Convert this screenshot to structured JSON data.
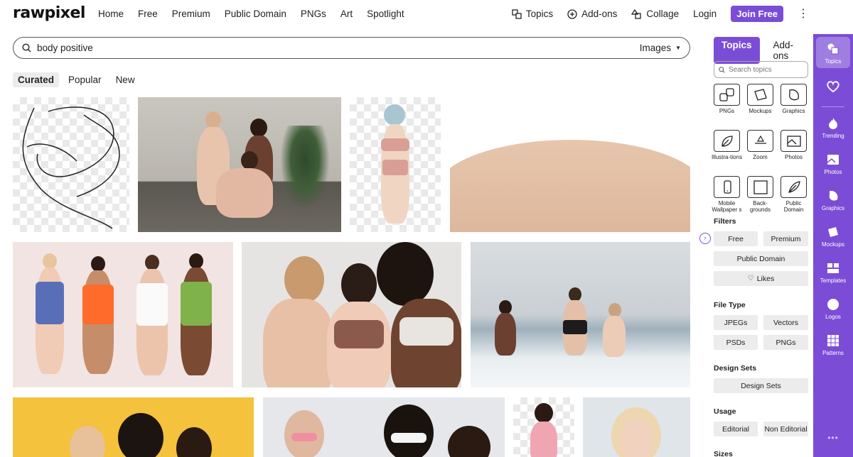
{
  "brand": "rawpixel",
  "nav": [
    "Home",
    "Free",
    "Premium",
    "Public Domain",
    "PNGs",
    "Art",
    "Spotlight"
  ],
  "header_right": {
    "topics": "Topics",
    "addons": "Add-ons",
    "collage": "Collage",
    "login": "Login",
    "join": "Join Free"
  },
  "search": {
    "value": "body positive",
    "type": "Images"
  },
  "sort_tabs": {
    "curated": "Curated",
    "popular": "Popular",
    "new": "New"
  },
  "panel": {
    "tabs": [
      "Topics",
      "Add-ons"
    ],
    "search_placeholder": "Search topics",
    "topics": [
      "PNGs",
      "Mockups",
      "Graphics",
      "Illustra-tions",
      "Zoom",
      "Photos",
      "Mobile Wallpaper s",
      "Back-grounds",
      "Public Domain"
    ],
    "filters_title": "Filters",
    "filters": {
      "free": "Free",
      "premium": "Premium",
      "public_domain": "Public Domain",
      "likes": "Likes"
    },
    "file_type_title": "File Type",
    "file_types": {
      "jpegs": "JPEGs",
      "vectors": "Vectors",
      "psds": "PSDs",
      "pngs": "PNGs"
    },
    "design_sets_title": "Design Sets",
    "design_sets": "Design Sets",
    "usage_title": "Usage",
    "usage": {
      "editorial": "Editorial",
      "non_editorial": "Non Editorial"
    },
    "sizes_title": "Sizes"
  },
  "rail": [
    "Topics",
    "Trending",
    "Photos",
    "Graphics",
    "Mockups",
    "Templates",
    "Logos",
    "Patterns"
  ],
  "colors": {
    "accent": "#7b4dd6"
  }
}
